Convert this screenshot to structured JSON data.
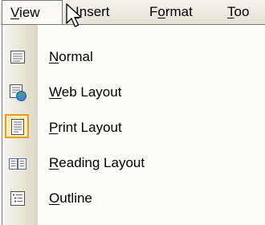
{
  "menubar": {
    "view": {
      "pre": "",
      "key": "V",
      "post": "iew"
    },
    "insert": {
      "pre": "",
      "key": "I",
      "post": "nsert"
    },
    "format": {
      "pre": "F",
      "key": "o",
      "post": "rmat"
    },
    "tools": {
      "pre": "",
      "key": "T",
      "post": "oo"
    }
  },
  "view_menu": {
    "items": [
      {
        "pre": "",
        "key": "N",
        "post": "ormal",
        "icon": "normal-view-icon"
      },
      {
        "pre": "",
        "key": "W",
        "post": "eb Layout",
        "icon": "web-layout-icon"
      },
      {
        "pre": "",
        "key": "P",
        "post": "rint Layout",
        "icon": "print-layout-icon",
        "state": "active"
      },
      {
        "pre": "",
        "key": "R",
        "post": "eading Layout",
        "icon": "reading-layout-icon"
      },
      {
        "pre": "",
        "key": "O",
        "post": "utline",
        "icon": "outline-icon"
      }
    ]
  },
  "colors": {
    "menubar_bg": "#ece9d8",
    "icon_strip": "#ddd9c5",
    "active_border": "#e89a2b",
    "active_fill": "#ffefb9"
  }
}
